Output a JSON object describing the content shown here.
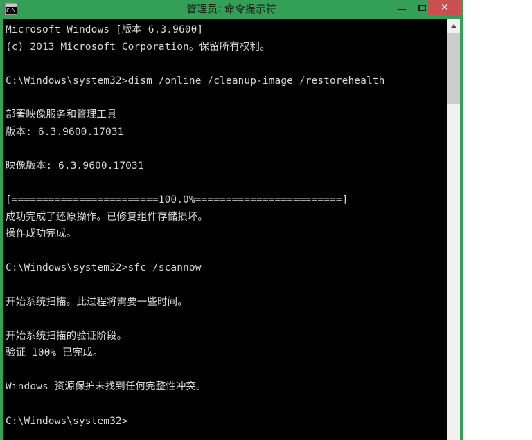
{
  "window": {
    "title": "管理员: 命令提示符",
    "icon_name": "console-window-icon",
    "icon_text": "C:\\",
    "title_bar_color": "#34a057",
    "close_button_color": "#c9504f",
    "console_background": "#000000",
    "console_foreground": "#d8d8d8"
  },
  "caption_buttons": {
    "minimize_label": "–",
    "maximize_label": "☐",
    "close_label": "✕"
  },
  "console": {
    "lines": [
      "Microsoft Windows [版本 6.3.9600]",
      "(c) 2013 Microsoft Corporation。保留所有权利。",
      "",
      "C:\\Windows\\system32>dism /online /cleanup-image /restorehealth",
      "",
      "部署映像服务和管理工具",
      "版本: 6.3.9600.17031",
      "",
      "映像版本: 6.3.9600.17031",
      "",
      "[========================100.0%========================]",
      "成功完成了还原操作。已修复组件存储损坏。",
      "操作成功完成。",
      "",
      "C:\\Windows\\system32>sfc /scannow",
      "",
      "开始系统扫描。此过程将需要一些时间。",
      "",
      "开始系统扫描的验证阶段。",
      "验证 100% 已完成。",
      "",
      "Windows 资源保护未找到任何完整性冲突。",
      "",
      "C:\\Windows\\system32>"
    ],
    "prompt_path": "C:\\Windows\\system32>",
    "commands": [
      "dism /online /cleanup-image /restorehealth",
      "sfc /scannow"
    ],
    "progress_percent": "100.0%",
    "verify_percent": "100%"
  },
  "scrollbar": {
    "up_arrow": "▲",
    "track_color": "#f0f0f0",
    "thumb_color": "#cdcdcd"
  }
}
